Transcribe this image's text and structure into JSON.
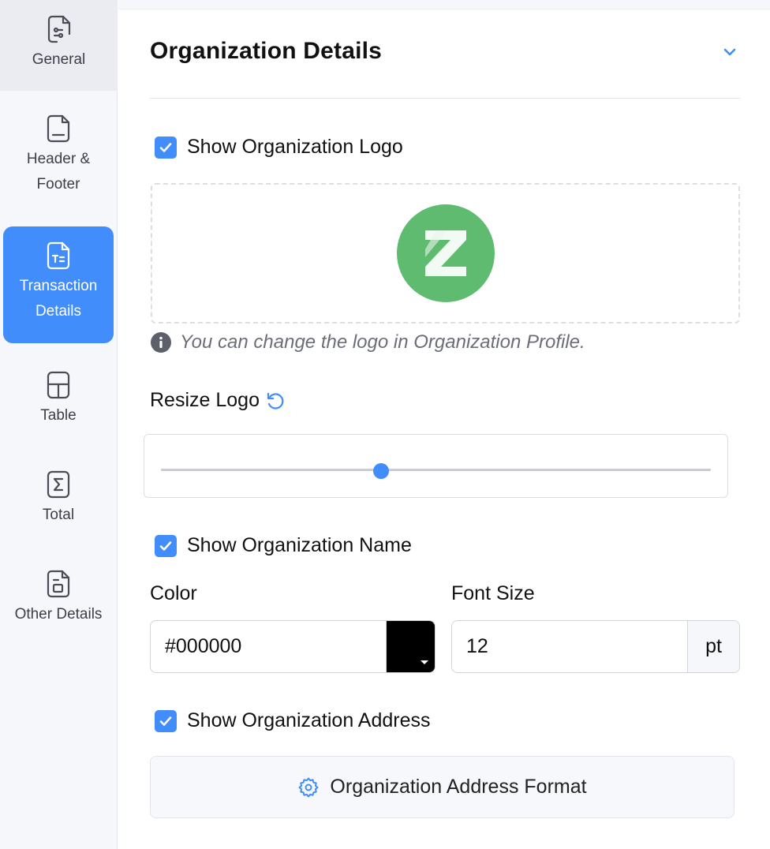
{
  "sidebar": {
    "items": [
      {
        "id": "general",
        "label": "General",
        "icon": "file-settings-icon"
      },
      {
        "id": "header-footer",
        "label": "Header &\nFooter",
        "icon": "file-icon"
      },
      {
        "id": "transaction-details",
        "label": "Transaction\nDetails",
        "icon": "file-text-icon",
        "active": true
      },
      {
        "id": "table",
        "label": "Table",
        "icon": "table-icon"
      },
      {
        "id": "total",
        "label": "Total",
        "icon": "sigma-icon"
      },
      {
        "id": "other-details",
        "label": "Other Details",
        "icon": "file-box-icon"
      }
    ]
  },
  "section": {
    "title": "Organization Details",
    "show_logo_label": "Show Organization Logo",
    "logo_letter": "Z",
    "logo_hint": "You can change the logo in Organization Profile.",
    "resize_label": "Resize Logo",
    "resize_value": 0.4,
    "show_name_label": "Show Organization Name",
    "color_label": "Color",
    "color_value": "#000000",
    "font_size_label": "Font Size",
    "font_size_value": "12",
    "font_size_unit": "pt",
    "show_address_label": "Show Organization Address",
    "address_format_button": "Organization Address Format"
  },
  "colors": {
    "accent": "#408dfb",
    "logo_green": "#5fbb6f",
    "sidebar_bg": "#f6f7fb"
  }
}
